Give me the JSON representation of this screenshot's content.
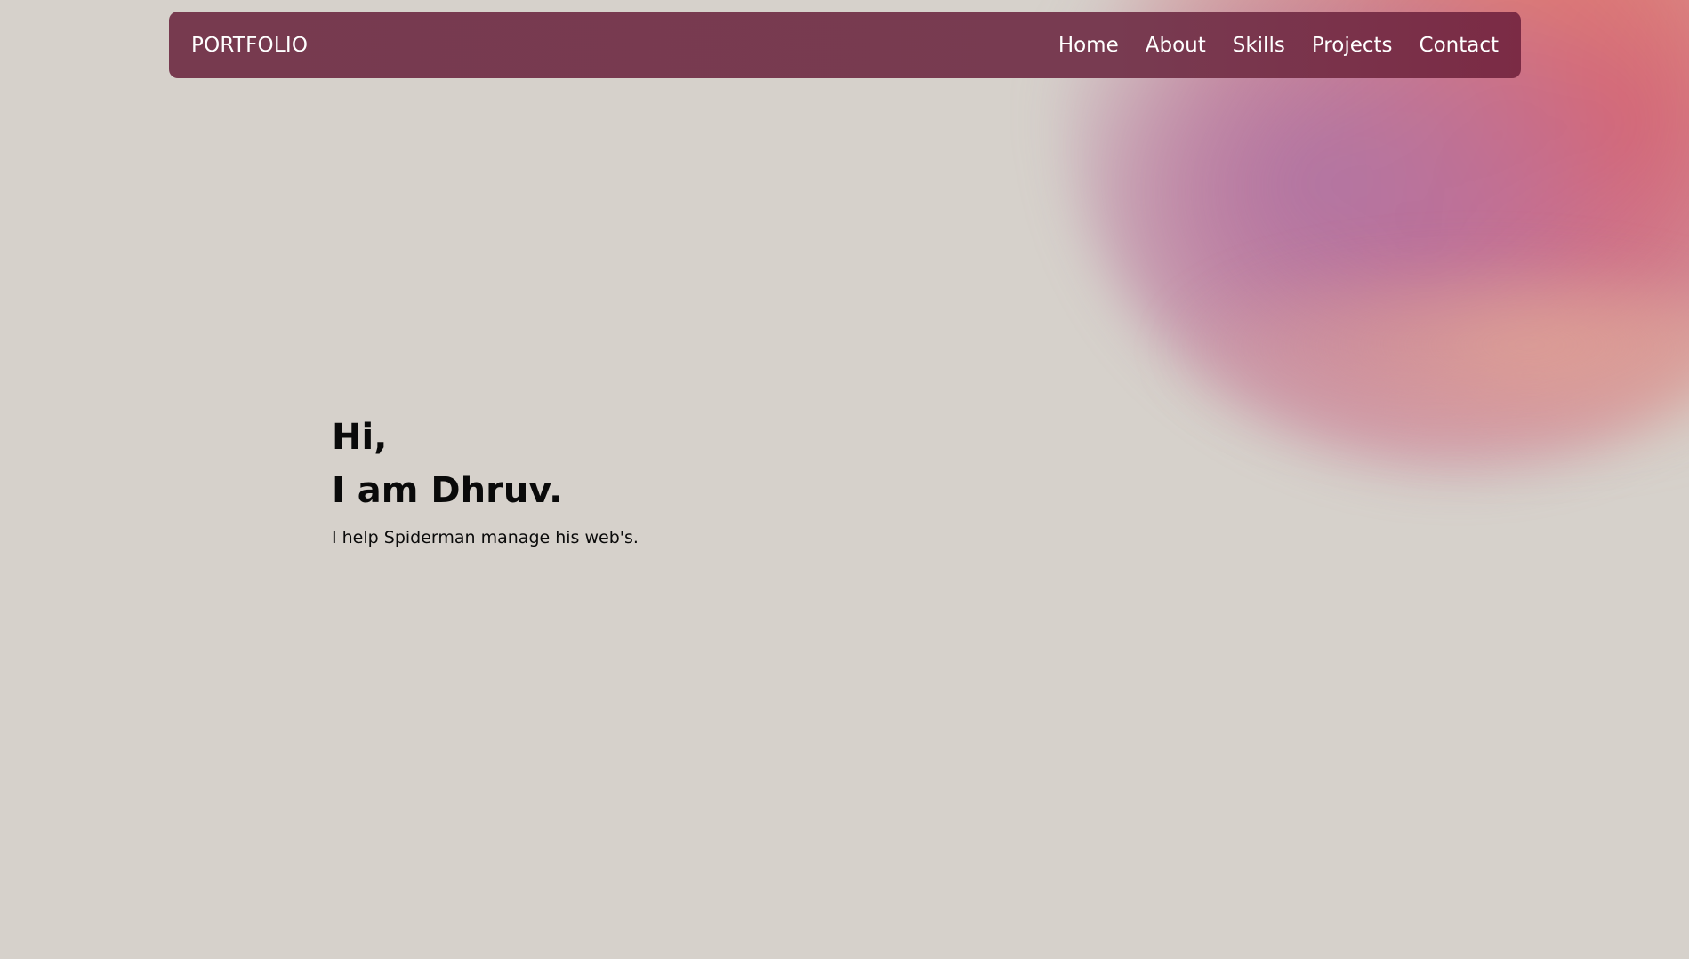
{
  "navbar": {
    "brand": "PORTFOLIO",
    "links": [
      {
        "label": "Home"
      },
      {
        "label": "About"
      },
      {
        "label": "Skills"
      },
      {
        "label": "Projects"
      },
      {
        "label": "Contact"
      }
    ]
  },
  "hero": {
    "greeting": "Hi,",
    "headline": "I am Dhruv.",
    "tagline": "I help Spiderman manage his web's."
  },
  "colors": {
    "background": "#d6d1cb",
    "navbar": "#773a4f",
    "nav_text": "#ffffff",
    "hero_text": "#0a0a0a",
    "blob_pink": "#c46892",
    "blob_coral": "#d6646e",
    "blob_peach": "#e88c6e"
  }
}
